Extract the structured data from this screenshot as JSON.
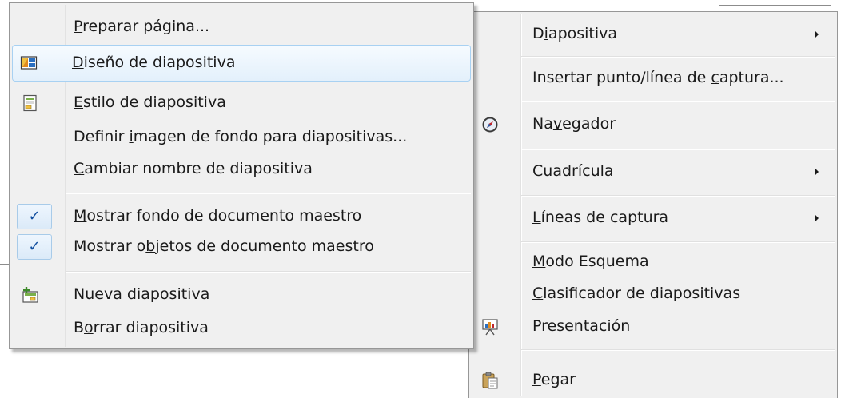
{
  "left_menu": {
    "items": [
      {
        "pre": "",
        "u": "P",
        "post": "reparar página..."
      },
      {
        "pre": "",
        "u": "D",
        "post": "iseño de diapositiva"
      },
      {
        "pre": "",
        "u": "E",
        "post": "stilo de diapositiva"
      },
      {
        "pre": "Definir ",
        "u": "i",
        "post": "magen de fondo para diapositivas..."
      },
      {
        "pre": "",
        "u": "C",
        "post": "ambiar nombre de diapositiva"
      },
      {
        "pre": "",
        "u": "M",
        "post": "ostrar fondo de documento maestro"
      },
      {
        "pre": "Mostrar o",
        "u": "b",
        "post": "jetos de documento maestro"
      },
      {
        "pre": "",
        "u": "N",
        "post": "ueva diapositiva"
      },
      {
        "pre": "B",
        "u": "o",
        "post": "rrar diapositiva"
      }
    ],
    "check_mark": "✓"
  },
  "right_menu": {
    "items": [
      {
        "pre": "D",
        "u": "i",
        "post": "apositiva"
      },
      {
        "pre": "Insertar punto/línea de ",
        "u": "c",
        "post": "aptura..."
      },
      {
        "pre": "Na",
        "u": "v",
        "post": "egador"
      },
      {
        "pre": "",
        "u": "C",
        "post": "uadrícula"
      },
      {
        "pre": "",
        "u": "L",
        "post": "íneas de captura"
      },
      {
        "pre": "",
        "u": "M",
        "post": "odo Esquema"
      },
      {
        "pre": "",
        "u": "C",
        "post": "lasificador de diapositivas"
      },
      {
        "pre": "",
        "u": "P",
        "post": "resentación"
      },
      {
        "pre": "",
        "u": "P",
        "post": "egar"
      }
    ]
  },
  "icons": {
    "slide_layout": "slide-layout-icon",
    "slide_style": "slide-style-icon",
    "new_slide": "new-slide-icon",
    "navigator": "navigator-compass-icon",
    "presentation": "presentation-icon",
    "paste": "paste-icon",
    "submenu_arrow": "submenu-arrow-icon"
  },
  "colors": {
    "hover_border": "#a8d1f2",
    "check": "#1450a0"
  }
}
